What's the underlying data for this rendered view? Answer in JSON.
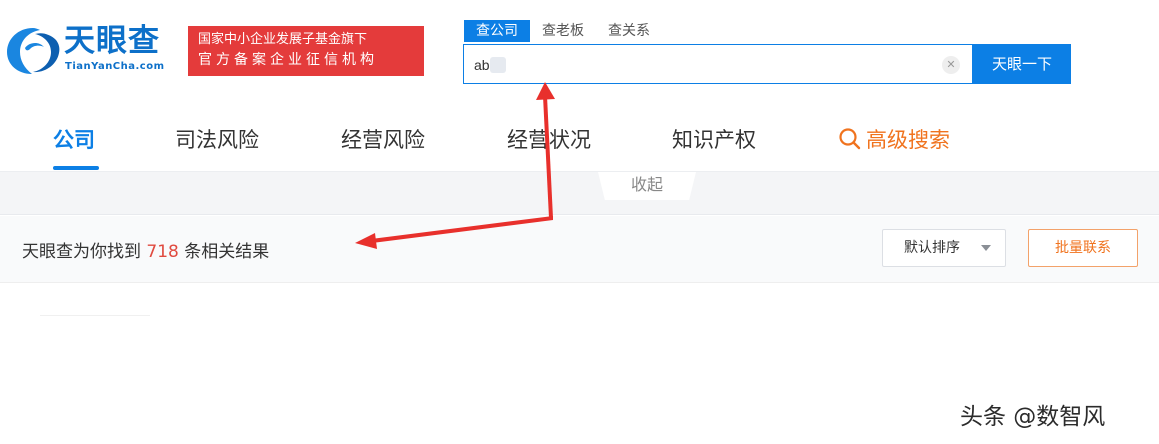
{
  "logo": {
    "title": "天眼查",
    "subtitle": "TianYanCha.com"
  },
  "gov_badge": {
    "line1": "国家中小企业发展子基金旗下",
    "line2": "官方备案企业征信机构"
  },
  "search": {
    "tabs": [
      {
        "label": "查公司",
        "active": true
      },
      {
        "label": "查老板",
        "active": false
      },
      {
        "label": "查关系",
        "active": false
      }
    ],
    "value": "ab",
    "button_label": "天眼一下",
    "clear_icon": "close-icon"
  },
  "nav": {
    "items": [
      {
        "label": "公司",
        "active": true
      },
      {
        "label": "司法风险",
        "active": false
      },
      {
        "label": "经营风险",
        "active": false
      },
      {
        "label": "经营状况",
        "active": false
      },
      {
        "label": "知识产权",
        "active": false
      }
    ],
    "advanced": {
      "label": "高级搜索",
      "icon": "search-icon"
    }
  },
  "collapse_label": "收起",
  "results": {
    "prefix": "天眼查为你找到",
    "count": "718",
    "suffix": "条相关结果",
    "sort_label": "默认排序",
    "batch_label": "批量联系"
  },
  "watermark": "头条 @数智风",
  "colors": {
    "brand_blue": "#0c7fe5",
    "badge_red": "#e43b3b",
    "accent_orange": "#f0731e",
    "count_red": "#e04a3f",
    "arrow_red": "#e8302c"
  }
}
